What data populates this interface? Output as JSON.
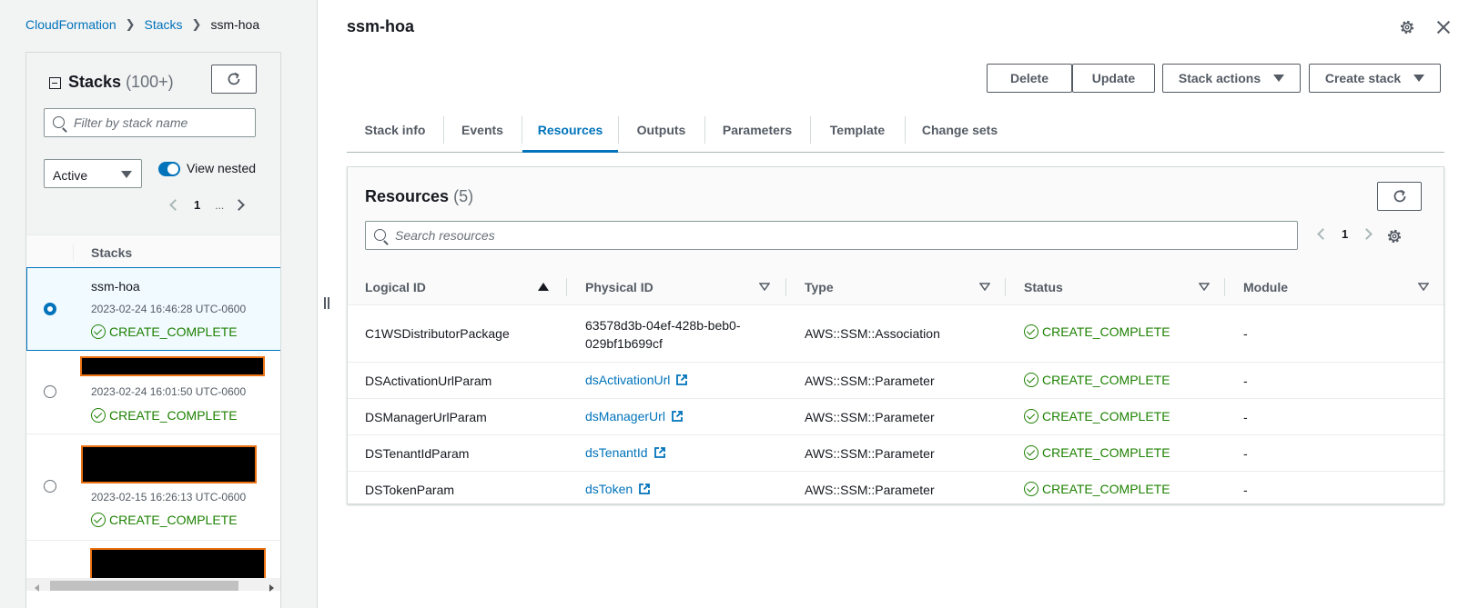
{
  "breadcrumb": {
    "root": "CloudFormation",
    "section": "Stacks",
    "current": "ssm-hoa"
  },
  "stacks_panel": {
    "title": "Stacks",
    "count": "(100+)",
    "filter_placeholder": "Filter by stack name",
    "status_filter": "Active",
    "view_nested_label": "View nested",
    "pagination": {
      "page": "1",
      "ellipsis": "..."
    },
    "column_header": "Stacks",
    "items": [
      {
        "name": "ssm-hoa",
        "time": "2023-02-24 16:46:28 UTC-0600",
        "status": "CREATE_COMPLETE",
        "selected": true
      },
      {
        "name": "",
        "time": "2023-02-24 16:01:50 UTC-0600",
        "status": "CREATE_COMPLETE",
        "selected": false
      },
      {
        "name": "",
        "time": "2023-02-15 16:26:13 UTC-0600",
        "status": "CREATE_COMPLETE",
        "selected": false
      },
      {
        "name": "",
        "time": "",
        "status": "",
        "selected": false
      }
    ]
  },
  "main": {
    "title": "ssm-hoa",
    "buttons": {
      "delete": "Delete",
      "update": "Update",
      "stack_actions": "Stack actions",
      "create_stack": "Create stack"
    },
    "tabs": [
      "Stack info",
      "Events",
      "Resources",
      "Outputs",
      "Parameters",
      "Template",
      "Change sets"
    ],
    "active_tab": "Resources"
  },
  "resources": {
    "title": "Resources",
    "count": "(5)",
    "search_placeholder": "Search resources",
    "page": "1",
    "columns": [
      "Logical ID",
      "Physical ID",
      "Type",
      "Status",
      "Module"
    ],
    "rows": [
      {
        "logical_id": "C1WSDistributorPackage",
        "physical_id_line1": "63578d3b-04ef-428b-beb0-",
        "physical_id_line2": "029bf1b699cf",
        "type": "AWS::SSM::Association",
        "status": "CREATE_COMPLETE",
        "module": "-"
      },
      {
        "logical_id": "DSActivationUrlParam",
        "physical_id": "dsActivationUrl",
        "type": "AWS::SSM::Parameter",
        "status": "CREATE_COMPLETE",
        "module": "-"
      },
      {
        "logical_id": "DSManagerUrlParam",
        "physical_id": "dsManagerUrl",
        "type": "AWS::SSM::Parameter",
        "status": "CREATE_COMPLETE",
        "module": "-"
      },
      {
        "logical_id": "DSTenantIdParam",
        "physical_id": "dsTenantId",
        "type": "AWS::SSM::Parameter",
        "status": "CREATE_COMPLETE",
        "module": "-"
      },
      {
        "logical_id": "DSTokenParam",
        "physical_id": "dsToken",
        "type": "AWS::SSM::Parameter",
        "status": "CREATE_COMPLETE",
        "module": "-"
      }
    ]
  },
  "colors": {
    "link": "#0073bb",
    "success": "#1d8102",
    "redaction": "#000000",
    "redaction_border": "#ec7211"
  }
}
